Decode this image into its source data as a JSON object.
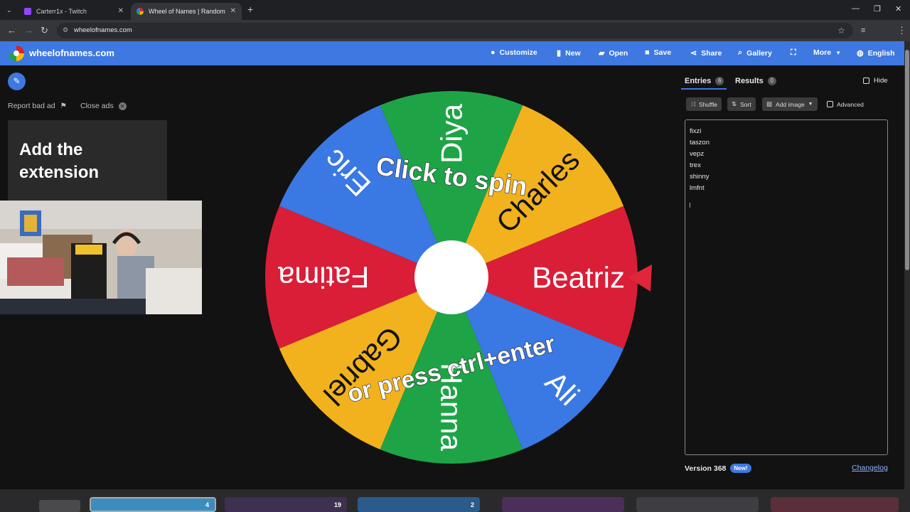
{
  "browser": {
    "tabs": [
      {
        "title": "Carterr1x - Twitch",
        "color": "#9146ff"
      },
      {
        "title": "Wheel of Names | Random nam",
        "color": "#3e78e0"
      }
    ],
    "url": "wheelofnames.com"
  },
  "header": {
    "site_name": "wheelofnames.com",
    "buttons": [
      "Customize",
      "New",
      "Open",
      "Save",
      "Share",
      "Gallery",
      "More",
      "English"
    ]
  },
  "sidebar": {
    "report_label": "Report bad ad",
    "close_ads_label": "Close ads",
    "ad_title": "Add the extension"
  },
  "wheel": {
    "segments": [
      {
        "name": "Beatriz",
        "color": "#da1e37"
      },
      {
        "name": "Charles",
        "color": "#f2b21d"
      },
      {
        "name": "Diya",
        "color": "#1ea446"
      },
      {
        "name": "Eric",
        "color": "#3a78e4"
      },
      {
        "name": "Fatima",
        "color": "#da1e37"
      },
      {
        "name": "Gabriel",
        "color": "#f2b21d"
      },
      {
        "name": "Hanna",
        "color": "#1ea446"
      },
      {
        "name": "Ali",
        "color": "#3a78e4"
      }
    ],
    "overlay_top": "Click to spin",
    "overlay_bottom": "or press ctrl+enter",
    "pointer_color": "#e0263a"
  },
  "panel": {
    "entries_tab": "Entries",
    "entries_count": "6",
    "results_tab": "Results",
    "results_count": "0",
    "hide_label": "Hide",
    "toolbar": {
      "shuffle": "Shuffle",
      "sort": "Sort",
      "add_image": "Add image",
      "advanced": "Advanced"
    },
    "entries": [
      "fixzi",
      "taszon",
      "vepz",
      "trex",
      "shinny",
      "lmfnt"
    ],
    "version": "Version 368",
    "new_badge": "New!",
    "changelog": "Changelog"
  },
  "taskbar": {
    "items": [
      "4",
      "19",
      "2"
    ]
  },
  "colors": {
    "brand_blue": "#3e78e0",
    "page_bg": "#121212"
  }
}
